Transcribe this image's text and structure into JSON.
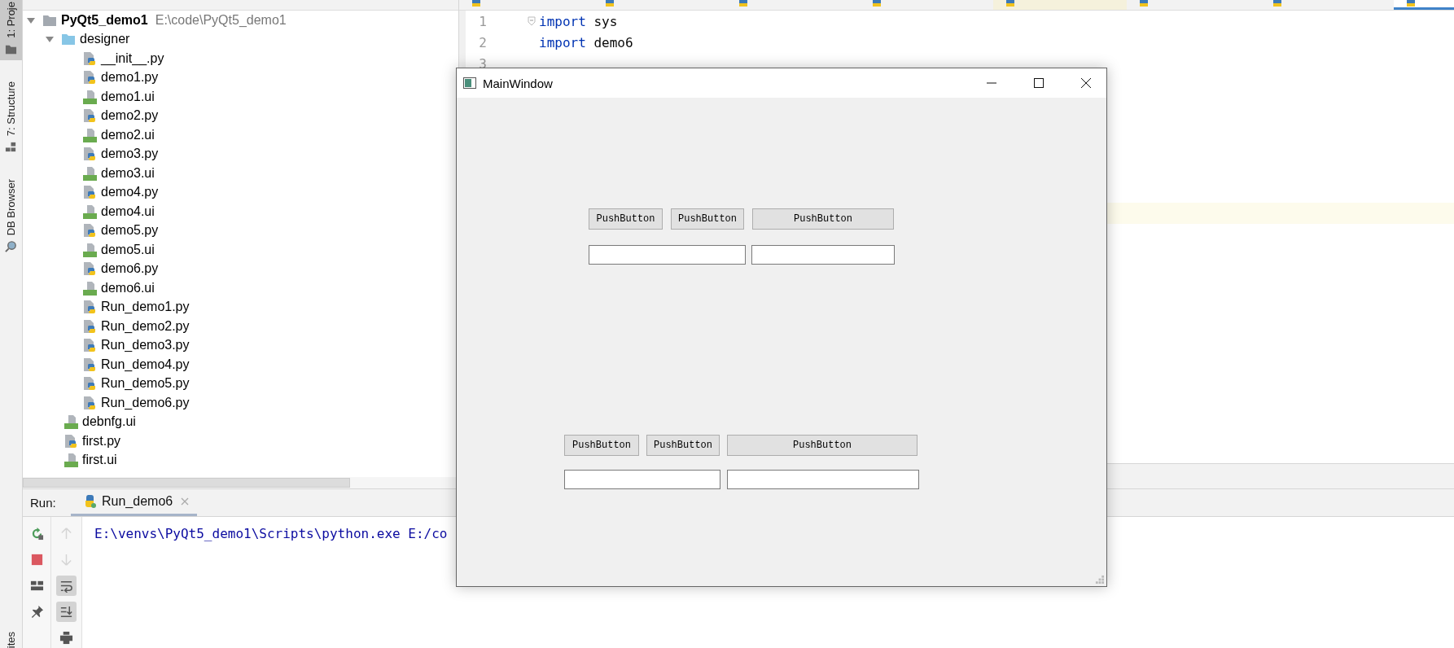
{
  "tool_strip": [
    {
      "label": "1: Proje",
      "kind": "folder",
      "selected": true
    },
    {
      "label": "7: Structure",
      "kind": "structure",
      "selected": false
    },
    {
      "label": "DB Browser",
      "kind": "db",
      "selected": false
    }
  ],
  "tool_strip_bottom": {
    "label": "ites"
  },
  "project_tree": {
    "root": {
      "name": "PyQt5_demo1",
      "path": "E:\\code\\PyQt5_demo1",
      "kind": "project",
      "expanded": true,
      "children": [
        {
          "name": "designer",
          "kind": "folder",
          "expanded": true,
          "children": [
            {
              "name": "__init__.py",
              "kind": "py"
            },
            {
              "name": "demo1.py",
              "kind": "py"
            },
            {
              "name": "demo1.ui",
              "kind": "ui"
            },
            {
              "name": "demo2.py",
              "kind": "py"
            },
            {
              "name": "demo2.ui",
              "kind": "ui"
            },
            {
              "name": "demo3.py",
              "kind": "py"
            },
            {
              "name": "demo3.ui",
              "kind": "ui"
            },
            {
              "name": "demo4.py",
              "kind": "py"
            },
            {
              "name": "demo4.ui",
              "kind": "ui"
            },
            {
              "name": "demo5.py",
              "kind": "py"
            },
            {
              "name": "demo5.ui",
              "kind": "ui"
            },
            {
              "name": "demo6.py",
              "kind": "py"
            },
            {
              "name": "demo6.ui",
              "kind": "ui"
            },
            {
              "name": "Run_demo1.py",
              "kind": "py"
            },
            {
              "name": "Run_demo2.py",
              "kind": "py"
            },
            {
              "name": "Run_demo3.py",
              "kind": "py"
            },
            {
              "name": "Run_demo4.py",
              "kind": "py"
            },
            {
              "name": "Run_demo5.py",
              "kind": "py"
            },
            {
              "name": "Run_demo6.py",
              "kind": "py"
            }
          ]
        },
        {
          "name": "debnfg.ui",
          "kind": "ui"
        },
        {
          "name": "first.py",
          "kind": "py"
        },
        {
          "name": "first.ui",
          "kind": "ui"
        }
      ]
    }
  },
  "editor": {
    "tabs": [
      {
        "kind": "plain",
        "selected": false
      },
      {
        "kind": "plain",
        "selected": false
      },
      {
        "kind": "plain",
        "selected": false
      },
      {
        "kind": "plain",
        "selected": false
      },
      {
        "kind": "tinted",
        "selected": false
      },
      {
        "kind": "plain",
        "selected": false
      },
      {
        "kind": "plain",
        "selected": false
      },
      {
        "kind": "plain",
        "selected": true
      }
    ],
    "lines": [
      {
        "number": "1",
        "fold": true,
        "tokens": [
          {
            "kind": "keyword",
            "text": "import"
          },
          {
            "kind": "name",
            "text": "sys"
          }
        ]
      },
      {
        "number": "2",
        "fold": false,
        "tokens": [
          {
            "kind": "keyword",
            "text": "import"
          },
          {
            "kind": "name",
            "text": "demo6"
          }
        ]
      },
      {
        "number": "3",
        "fold": false
      }
    ]
  },
  "run_panel": {
    "label": "Run:",
    "tabs": [
      {
        "title": "Run_demo6",
        "selected": true
      }
    ],
    "toolbar": [
      {
        "kind": "rerun",
        "on": false,
        "disabled": false
      },
      {
        "kind": "stop",
        "on": false,
        "disabled": false
      },
      {
        "kind": "layout",
        "on": false,
        "disabled": false
      },
      {
        "kind": "pin",
        "on": false,
        "disabled": false
      }
    ],
    "toolbar_2": [
      {
        "kind": "up",
        "on": false,
        "disabled": true
      },
      {
        "kind": "down",
        "on": false,
        "disabled": true
      },
      {
        "kind": "wrap",
        "on": true,
        "disabled": false
      },
      {
        "kind": "scroll-end",
        "on": true,
        "disabled": false
      },
      {
        "kind": "print",
        "on": false,
        "disabled": false
      }
    ],
    "output": "E:\\venvs\\PyQt5_demo1\\Scripts\\python.exe E:/co"
  },
  "main_window": {
    "title": "MainWindow",
    "groups": [
      {
        "widgets": [
          {
            "kind": "push_button",
            "text": "PushButton"
          },
          {
            "kind": "push_button",
            "text": "PushButton"
          },
          {
            "kind": "push_button",
            "text": "PushButton"
          },
          {
            "kind": "line_edit"
          },
          {
            "kind": "line_edit"
          }
        ]
      },
      {
        "widgets": [
          {
            "kind": "push_button",
            "text": "PushButton"
          },
          {
            "kind": "push_button",
            "text": "PushButton"
          },
          {
            "kind": "push_button",
            "text": "PushButton"
          },
          {
            "kind": "line_edit"
          },
          {
            "kind": "line_edit"
          }
        ]
      }
    ]
  }
}
